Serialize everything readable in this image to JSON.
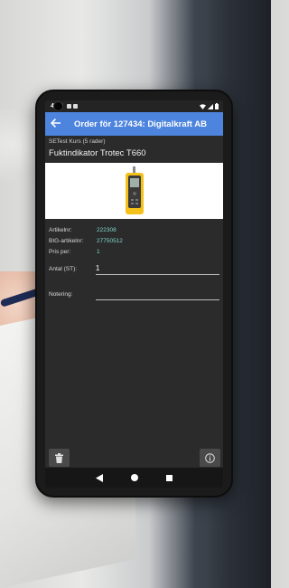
{
  "status_bar": {
    "time": "4:20"
  },
  "app_bar": {
    "back_icon": "arrow-left-icon",
    "title": "Order för 127434: Digitalkraft AB"
  },
  "subheader": "SETest Kurs (5 rader)",
  "product": {
    "name": "Fuktindikator Trotec T660"
  },
  "info": [
    {
      "label": "Artikelnr:",
      "value": "222308"
    },
    {
      "label": "BIG-artikelnr:",
      "value": "27750512"
    },
    {
      "label": "Pris per:",
      "value": "1"
    }
  ],
  "fields": {
    "antal": {
      "label": "Antal (ST):",
      "value": "1"
    },
    "notering": {
      "label": "Notering:",
      "value": ""
    }
  },
  "buttons": {
    "delete_icon": "trash-icon",
    "info_icon": "info-icon"
  },
  "nav": {
    "back_icon": "nav-back-icon",
    "home_icon": "nav-home-icon",
    "recents_icon": "nav-recents-icon"
  },
  "colors": {
    "app_bar": "#4d84dd",
    "background": "#2b2b2b",
    "value_text": "#7fd4c8"
  }
}
